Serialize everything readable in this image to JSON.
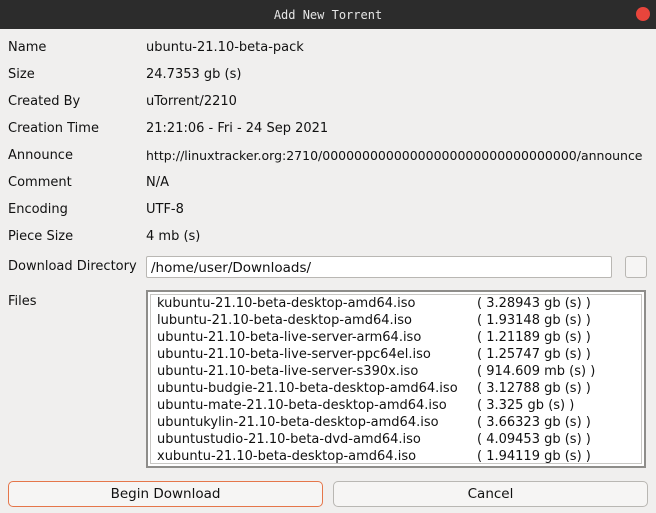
{
  "window": {
    "title": "Add New Torrent"
  },
  "fields": [
    {
      "label": "Name",
      "value": "ubuntu-21.10-beta-pack"
    },
    {
      "label": "Size",
      "value": "24.7353 gb (s)"
    },
    {
      "label": "Created By",
      "value": "uTorrent/2210"
    },
    {
      "label": "Creation Time",
      "value": "21:21:06 - Fri - 24 Sep 2021"
    },
    {
      "label": "Announce",
      "value": "http://linuxtracker.org:2710/00000000000000000000000000000000/announce"
    },
    {
      "label": "Comment",
      "value": "N/A"
    },
    {
      "label": "Encoding",
      "value": "UTF-8"
    },
    {
      "label": "Piece Size",
      "value": "4 mb (s)"
    }
  ],
  "download_directory": {
    "label": "Download Directory",
    "value": "/home/user/Downloads/"
  },
  "files": {
    "label": "Files",
    "items": [
      {
        "name": "kubuntu-21.10-beta-desktop-amd64.iso",
        "size": "( 3.28943 gb (s) )"
      },
      {
        "name": "lubuntu-21.10-beta-desktop-amd64.iso",
        "size": "( 1.93148 gb (s) )"
      },
      {
        "name": "ubuntu-21.10-beta-live-server-arm64.iso",
        "size": "( 1.21189 gb (s) )"
      },
      {
        "name": "ubuntu-21.10-beta-live-server-ppc64el.iso",
        "size": "( 1.25747 gb (s) )"
      },
      {
        "name": "ubuntu-21.10-beta-live-server-s390x.iso",
        "size": "( 914.609 mb (s) )"
      },
      {
        "name": "ubuntu-budgie-21.10-beta-desktop-amd64.iso",
        "size": "( 3.12788 gb (s) )"
      },
      {
        "name": "ubuntu-mate-21.10-beta-desktop-amd64.iso",
        "size": "( 3.325 gb (s) )"
      },
      {
        "name": "ubuntukylin-21.10-beta-desktop-amd64.iso",
        "size": "( 3.66323 gb (s) )"
      },
      {
        "name": "ubuntustudio-21.10-beta-dvd-amd64.iso",
        "size": "( 4.09453 gb (s) )"
      },
      {
        "name": "xubuntu-21.10-beta-desktop-amd64.iso",
        "size": "( 1.94119 gb (s) )"
      }
    ]
  },
  "buttons": {
    "begin": "Begin Download",
    "cancel": "Cancel"
  },
  "colors": {
    "titlebar": "#2c2c2c",
    "close": "#e8453c",
    "focus_border": "#e5764a",
    "background": "#f0efee"
  }
}
